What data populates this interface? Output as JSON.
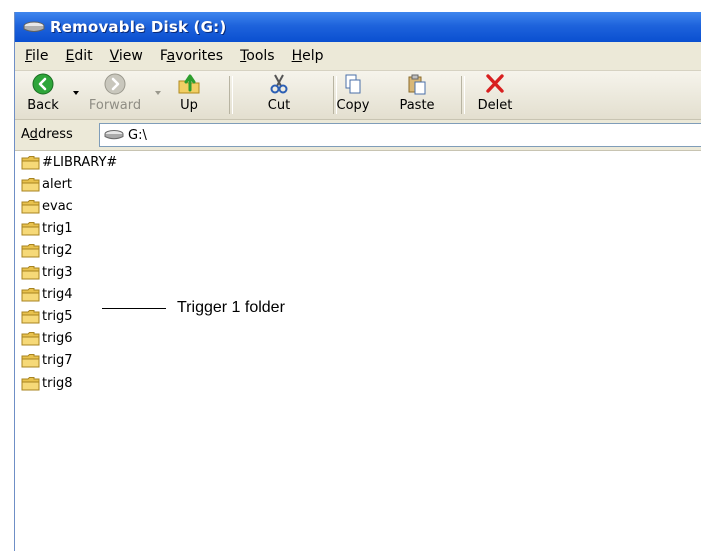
{
  "window": {
    "title": "Removable Disk (G:)"
  },
  "menu": {
    "items": [
      {
        "label": "File",
        "accel": "F",
        "rest": "ile"
      },
      {
        "label": "Edit",
        "accel": "E",
        "rest": "dit"
      },
      {
        "label": "View",
        "accel": "V",
        "rest": "iew"
      },
      {
        "label": "Favorites",
        "pre": "F",
        "accel": "a",
        "rest": "vorites"
      },
      {
        "label": "Tools",
        "accel": "T",
        "rest": "ools"
      },
      {
        "label": "Help",
        "accel": "H",
        "rest": "elp"
      }
    ]
  },
  "toolbar": {
    "back_label": "Back",
    "forward_label": "Forward",
    "up_label": "Up",
    "cut_label": "Cut",
    "copy_label": "Copy",
    "paste_label": "Paste",
    "delete_label": "Delet"
  },
  "address": {
    "label": "Address",
    "value": "G:\\"
  },
  "files": [
    {
      "name": "#LIBRARY#"
    },
    {
      "name": "alert"
    },
    {
      "name": "evac"
    },
    {
      "name": "trig1"
    },
    {
      "name": "trig2"
    },
    {
      "name": "trig3"
    },
    {
      "name": "trig4"
    },
    {
      "name": "trig5"
    },
    {
      "name": "trig6"
    },
    {
      "name": "trig7"
    },
    {
      "name": "trig8"
    }
  ],
  "annotation": {
    "text": "Trigger 1 folder"
  },
  "colors": {
    "titlebar": "#1e63dc",
    "folder": "#f2cf64",
    "back_green": "#2ea53a",
    "delete_red": "#d82020"
  }
}
